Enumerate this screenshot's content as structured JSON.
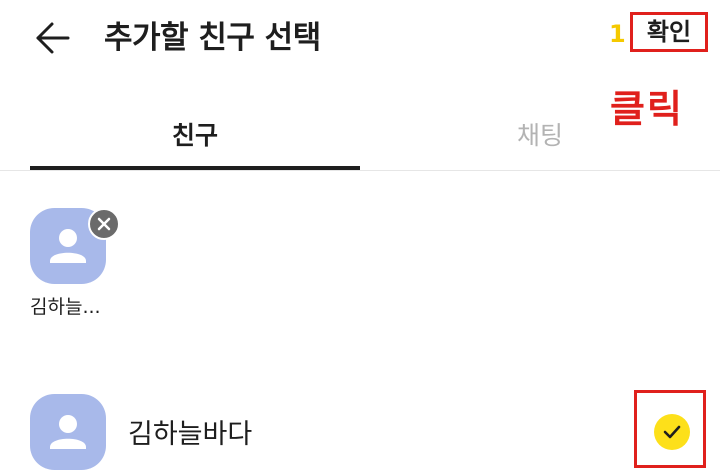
{
  "header": {
    "title": "추가할 친구 선택",
    "selected_count": "1",
    "confirm_label": "확인",
    "back_icon": "arrow-left-icon"
  },
  "annotation": {
    "click_label": "클릭",
    "highlight_color": "#e0201c"
  },
  "tabs": [
    {
      "label": "친구",
      "active": true
    },
    {
      "label": "채팅",
      "active": false
    }
  ],
  "selected_chips": [
    {
      "name": "김하늘...",
      "avatar_icon": "default-profile-icon",
      "remove_icon": "close-icon"
    }
  ],
  "friends": [
    {
      "name": "김하늘바다",
      "avatar_icon": "default-profile-icon",
      "checked": true,
      "check_icon": "checkmark-icon"
    }
  ],
  "colors": {
    "accent_yellow": "#fde01a",
    "count_yellow": "#f5c900",
    "avatar_bg": "#a8b9ea",
    "text_primary": "#1e1e1e",
    "text_inactive": "#b3b3b3"
  }
}
